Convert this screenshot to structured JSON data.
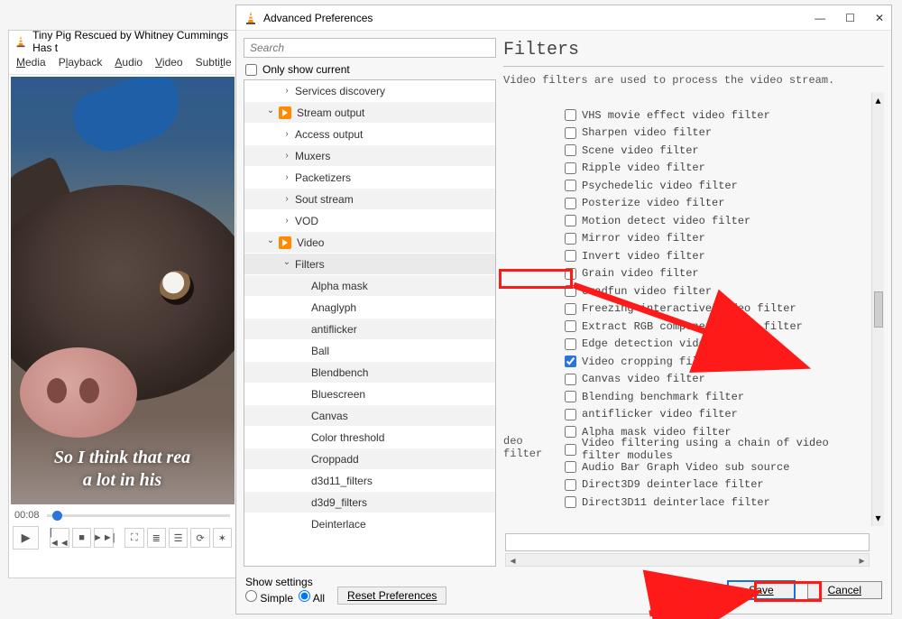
{
  "vlc": {
    "title": "Tiny Pig Rescued by Whitney Cummings Has t",
    "menu": {
      "media": "Media",
      "playback": "Playback",
      "audio": "Audio",
      "video": "Video",
      "subtitle": "Subtitle"
    },
    "caption": "So I think that rea\na lot in his",
    "time": "00:08",
    "buttons": {
      "play": "▶",
      "prev": "|◄◄",
      "stop": "■",
      "next": "►►|",
      "full": "⛶",
      "ext": "≣",
      "playlist": "☰",
      "loop": "⟳",
      "shuffle": "✶"
    }
  },
  "prefs": {
    "title": "Advanced Preferences",
    "search_placeholder": "Search",
    "only_show": "Only show current",
    "tree": [
      {
        "indent": 2,
        "chev": ">",
        "label": "Services discovery"
      },
      {
        "indent": 1,
        "chev": "v",
        "icon": true,
        "label": "Stream output"
      },
      {
        "indent": 2,
        "chev": ">",
        "label": "Access output"
      },
      {
        "indent": 2,
        "chev": ">",
        "label": "Muxers"
      },
      {
        "indent": 2,
        "chev": ">",
        "label": "Packetizers"
      },
      {
        "indent": 2,
        "chev": ">",
        "label": "Sout stream"
      },
      {
        "indent": 2,
        "chev": ">",
        "label": "VOD"
      },
      {
        "indent": 1,
        "chev": "v",
        "icon": true,
        "label": "Video"
      },
      {
        "indent": 2,
        "chev": "v",
        "label": "Filters",
        "selected": true
      },
      {
        "indent": 3,
        "label": "Alpha mask"
      },
      {
        "indent": 3,
        "label": "Anaglyph"
      },
      {
        "indent": 3,
        "label": "antiflicker"
      },
      {
        "indent": 3,
        "label": "Ball"
      },
      {
        "indent": 3,
        "label": "Blendbench"
      },
      {
        "indent": 3,
        "label": "Bluescreen"
      },
      {
        "indent": 3,
        "label": "Canvas"
      },
      {
        "indent": 3,
        "label": "Color threshold"
      },
      {
        "indent": 3,
        "label": "Croppadd"
      },
      {
        "indent": 3,
        "label": "d3d11_filters"
      },
      {
        "indent": 3,
        "label": "d3d9_filters"
      },
      {
        "indent": 3,
        "label": "Deinterlace"
      }
    ],
    "right": {
      "title": "Filters",
      "desc": "Video filters are used to process the video stream.",
      "leftcol": "deo filter",
      "filters": [
        {
          "label": "VHS movie effect video filter",
          "checked": false
        },
        {
          "label": "Sharpen video filter",
          "checked": false
        },
        {
          "label": "Scene video filter",
          "checked": false
        },
        {
          "label": "Ripple video filter",
          "checked": false
        },
        {
          "label": "Psychedelic video filter",
          "checked": false
        },
        {
          "label": "Posterize video filter",
          "checked": false
        },
        {
          "label": "Motion detect video filter",
          "checked": false
        },
        {
          "label": "Mirror video filter",
          "checked": false
        },
        {
          "label": "Invert video filter",
          "checked": false
        },
        {
          "label": "Grain video filter",
          "checked": false
        },
        {
          "label": "Gradfun video filter",
          "checked": false
        },
        {
          "label": "Freezing interactive video filter",
          "checked": false
        },
        {
          "label": "Extract RGB component video filter",
          "checked": false
        },
        {
          "label": "Edge detection video filter",
          "checked": false
        },
        {
          "label": "Video cropping filter",
          "checked": true
        },
        {
          "label": "Canvas video filter",
          "checked": false
        },
        {
          "label": "Blending benchmark filter",
          "checked": false
        },
        {
          "label": "antiflicker video filter",
          "checked": false
        },
        {
          "label": "Alpha mask video filter",
          "checked": false
        },
        {
          "label": "Video filtering using a chain of video filter modules",
          "checked": false
        },
        {
          "label": "Audio Bar Graph Video sub source",
          "checked": false
        },
        {
          "label": "Direct3D9 deinterlace filter",
          "checked": false
        },
        {
          "label": "Direct3D11 deinterlace filter",
          "checked": false
        }
      ]
    },
    "footer": {
      "show_settings": "Show settings",
      "simple": "Simple",
      "all": "All",
      "selected": "all",
      "reset": "Reset Preferences",
      "save": "Save",
      "cancel": "Cancel"
    }
  },
  "win": {
    "min": "—",
    "max": "☐",
    "close": "✕"
  }
}
